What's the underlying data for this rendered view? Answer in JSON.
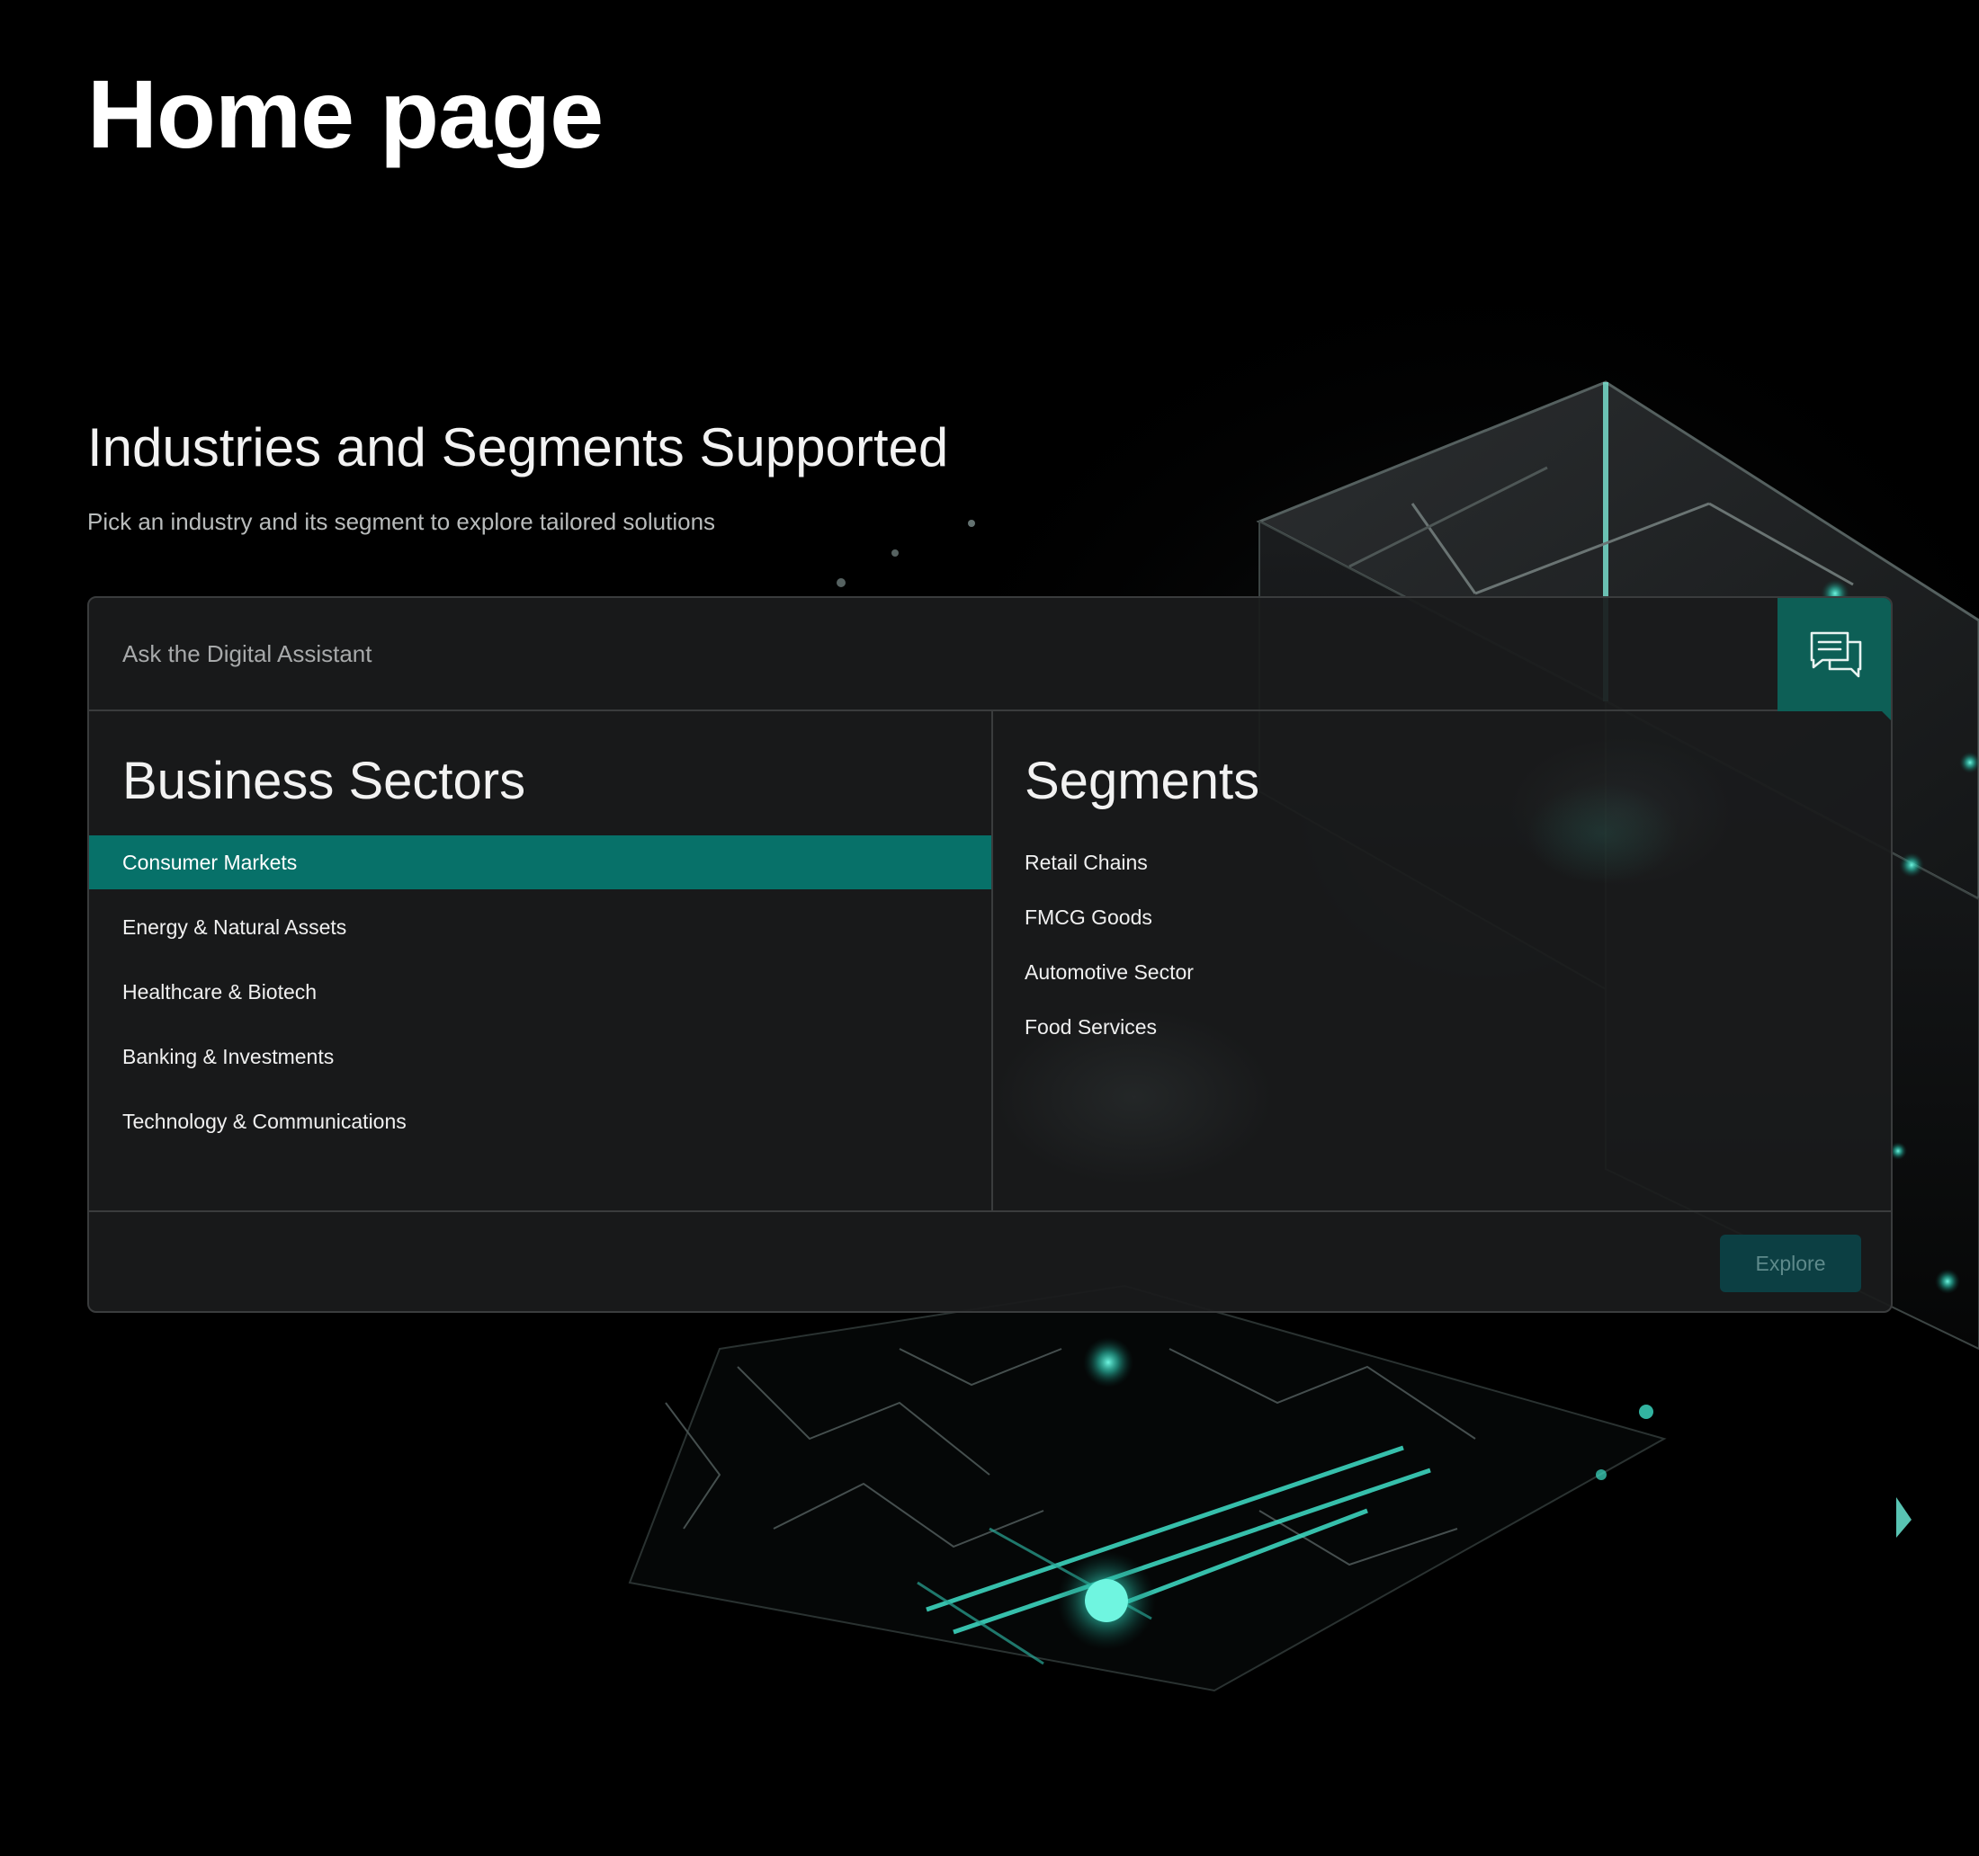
{
  "page": {
    "title": "Home page"
  },
  "section": {
    "title": "Industries and Segments Supported",
    "subtitle": "Pick an industry and its segment to explore tailored solutions"
  },
  "assistant": {
    "placeholder": "Ask the Digital Assistant",
    "icon": "chat-bubbles-icon"
  },
  "sectors": {
    "heading": "Business Sectors",
    "selected_index": 0,
    "items": [
      "Consumer Markets",
      "Energy & Natural Assets",
      "Healthcare & Biotech",
      "Banking & Investments",
      "Technology & Communications"
    ]
  },
  "segments": {
    "heading": "Segments",
    "items": [
      "Retail Chains",
      "FMCG Goods",
      "Automotive Sector",
      "Food Services"
    ]
  },
  "footer": {
    "explore_label": "Explore"
  },
  "colors": {
    "accent": "#077169",
    "assistant_button": "#0d5f56",
    "explore_button": "#0c3f43",
    "glow": "#3fe0c8",
    "background": "#000000"
  }
}
